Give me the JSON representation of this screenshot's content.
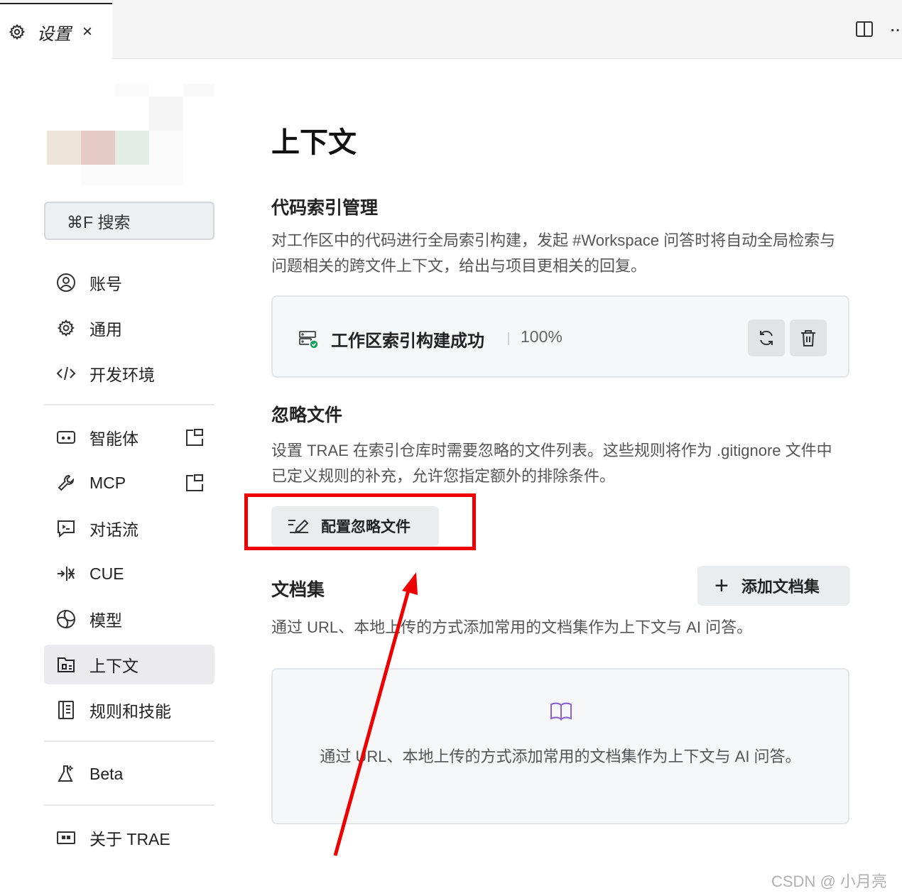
{
  "tab": {
    "label": "设置",
    "close": "×"
  },
  "header": {
    "more": "···"
  },
  "sidebar": {
    "search_label": "⌘F 搜索",
    "items": [
      {
        "label": "账号",
        "icon": "user-circle-icon"
      },
      {
        "label": "通用",
        "icon": "gear-icon"
      },
      {
        "label": "开发环境",
        "icon": "code-icon"
      },
      {
        "label": "智能体",
        "icon": "agent-icon",
        "external": true
      },
      {
        "label": "MCP",
        "icon": "wrench-icon",
        "external": true
      },
      {
        "label": "对话流",
        "icon": "chat-flow-icon"
      },
      {
        "label": "CUE",
        "icon": "cue-icon"
      },
      {
        "label": "模型",
        "icon": "model-icon"
      },
      {
        "label": "上下文",
        "icon": "context-icon",
        "active": true
      },
      {
        "label": "规则和技能",
        "icon": "rules-icon"
      },
      {
        "label": "Beta",
        "icon": "flask-icon"
      },
      {
        "label": "关于 TRAE",
        "icon": "about-icon"
      }
    ]
  },
  "main": {
    "title": "上下文",
    "index": {
      "title": "代码索引管理",
      "desc": "对工作区中的代码进行全局索引构建，发起 #Workspace 问答时将自动全局检索与问题相关的跨文件上下文，给出与项目更相关的回复。",
      "status": "工作区索引构建成功",
      "percent": "100%"
    },
    "ignore": {
      "title": "忽略文件",
      "desc": "设置 TRAE 在索引仓库时需要忽略的文件列表。这些规则将作为 .gitignore 文件中已定义规则的补充，允许您指定额外的排除条件。",
      "button": "配置忽略文件"
    },
    "docs": {
      "title": "文档集",
      "add_button": "添加文档集",
      "desc": "通过 URL、本地上传的方式添加常用的文档集作为上下文与 AI 问答。",
      "empty_text": "通过 URL、本地上传的方式添加常用的文档集作为上下文与 AI 问答。"
    }
  },
  "watermark": "CSDN @  小月亮",
  "colors": {
    "accent_purple": "#8a63d2",
    "highlight_red": "#ee0000",
    "success_green": "#1aa260"
  }
}
